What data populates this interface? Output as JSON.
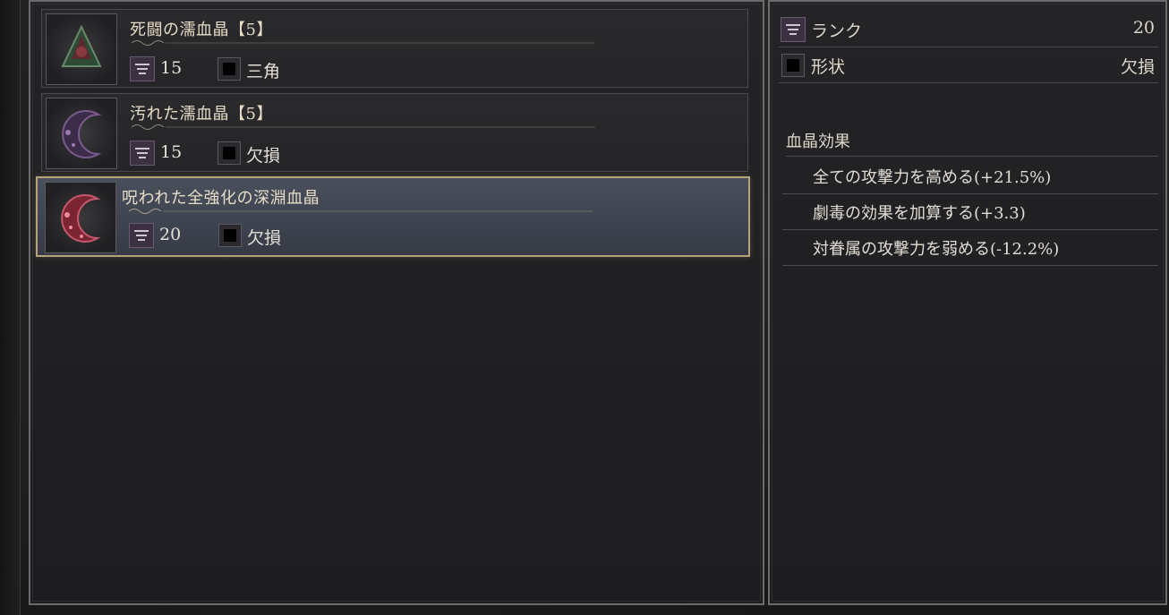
{
  "items": [
    {
      "title": "死闘の濡血晶【5】",
      "rank": "15",
      "shape": "三角",
      "icon": "triangle-gem-icon",
      "selected": false
    },
    {
      "title": "汚れた濡血晶【5】",
      "rank": "15",
      "shape": "欠損",
      "icon": "crescent-gem-icon",
      "selected": false
    },
    {
      "title": "呪われた全強化の深淵血晶",
      "rank": "20",
      "shape": "欠損",
      "icon": "crescent-gem-icon",
      "selected": true
    }
  ],
  "details": {
    "rank_label": "ランク",
    "rank_value": "20",
    "shape_label": "形状",
    "shape_value": "欠損",
    "effects_title": "血晶効果",
    "effects": [
      "全ての攻撃力を高める(+21.5%)",
      "劇毒の効果を加算する(+3.3)",
      "対眷属の攻撃力を弱める(-12.2%)"
    ]
  },
  "colors": {
    "selected_border": "#b5a27a",
    "rank_icon_bg": "#3b3142"
  }
}
